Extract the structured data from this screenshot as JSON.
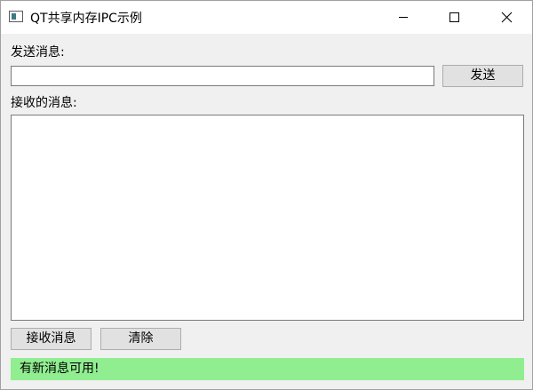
{
  "window": {
    "title": "QT共享内存IPC示例"
  },
  "icons": {
    "app": "app-window-icon",
    "minimize": "minimize-icon",
    "maximize": "maximize-icon",
    "close": "close-icon"
  },
  "send": {
    "label": "发送消息:",
    "input_value": "",
    "input_placeholder": "",
    "button_label": "发送"
  },
  "receive": {
    "label": "接收的消息:",
    "content": ""
  },
  "actions": {
    "receive_button": "接收消息",
    "clear_button": "清除"
  },
  "status": {
    "text": "有新消息可用!",
    "color": "#90ee90"
  }
}
